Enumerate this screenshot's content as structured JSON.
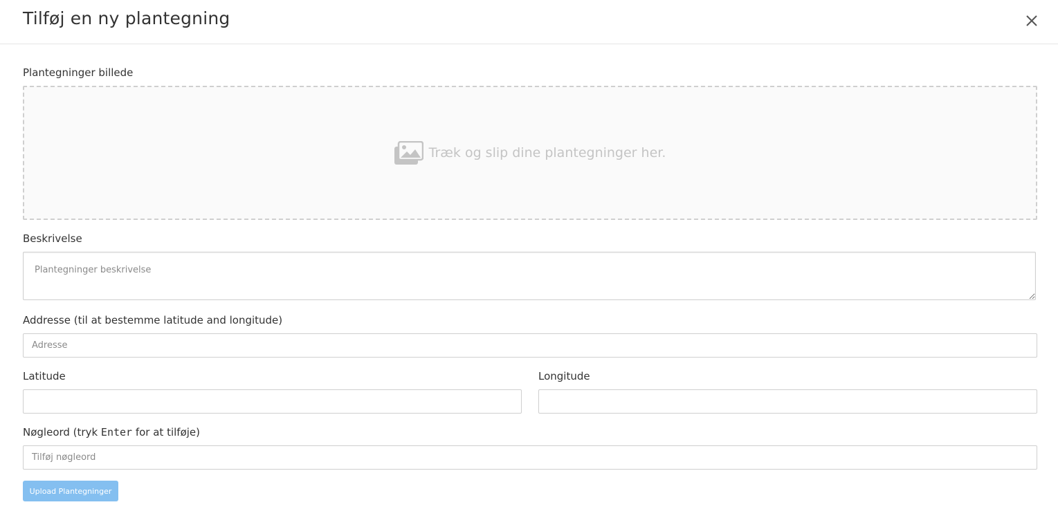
{
  "modal": {
    "title": "Tilføj en ny plantegning",
    "close_icon": "close-icon"
  },
  "form": {
    "image_label": "Plantegninger billede",
    "dropzone": {
      "icon": "images-icon",
      "text": "Træk og slip dine plantegninger her."
    },
    "description_label": "Beskrivelse",
    "description_placeholder": "Plantegninger beskrivelse",
    "description_value": "",
    "address_label": "Addresse (til at bestemme latitude and longitude)",
    "address_placeholder": "Adresse",
    "address_value": "",
    "latitude_label": "Latitude",
    "latitude_value": "",
    "longitude_label": "Longitude",
    "longitude_value": "",
    "keywords_label_prefix": "Nøgleord (tryk ",
    "keywords_label_key": "Enter",
    "keywords_label_suffix": " for at tilføje)",
    "keywords_placeholder": "Tilføj nøgleord",
    "upload_button": "Upload Plantegninger"
  },
  "colors": {
    "upload_button": "#84bff0",
    "dropzone_bg": "#fafafa",
    "dropzone_text": "#c4c4c4"
  }
}
